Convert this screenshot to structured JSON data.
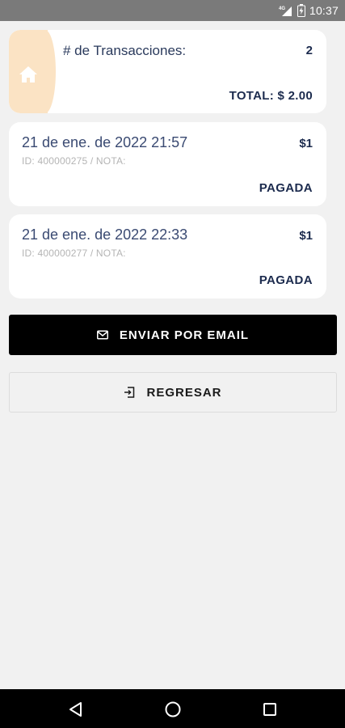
{
  "status_bar": {
    "network": "4G",
    "time": "10:37"
  },
  "summary": {
    "transactions_label": "# de Transacciones:",
    "transactions_count": "2",
    "total_label": "TOTAL: $ 2.00",
    "icon": "home-icon"
  },
  "transactions": [
    {
      "date": "21 de ene. de 2022 21:57",
      "amount": "$1",
      "meta": "ID: 400000275 / NOTA:",
      "status": "PAGADA"
    },
    {
      "date": "21 de ene. de 2022 22:33",
      "amount": "$1",
      "meta": "ID: 400000277 / NOTA:",
      "status": "PAGADA"
    }
  ],
  "buttons": {
    "email_label": "ENVIAR POR EMAIL",
    "back_label": "REGRESAR"
  },
  "colors": {
    "accent_stripe": "#fbe3c4",
    "text_primary": "#1c2b4e",
    "button_primary_bg": "#000000"
  }
}
